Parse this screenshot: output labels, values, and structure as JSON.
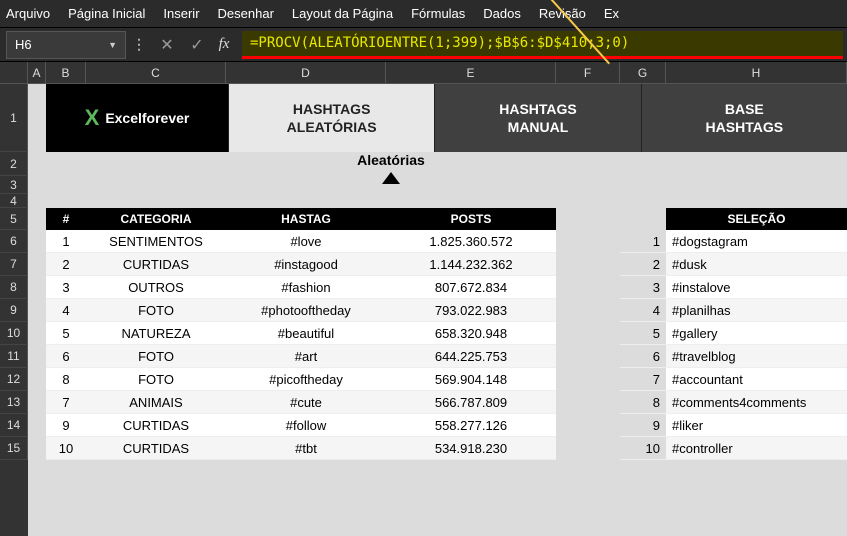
{
  "menu": {
    "items": [
      "Arquivo",
      "Página Inicial",
      "Inserir",
      "Desenhar",
      "Layout da Página",
      "Fórmulas",
      "Dados",
      "Revisão",
      "Ex"
    ]
  },
  "namebox": {
    "value": "H6"
  },
  "formula": {
    "value": "=PROCV(ALEATÓRIOENTRE(1;399);$B$6:$D$410;3;0)"
  },
  "columns": {
    "labels": [
      "A",
      "B",
      "C",
      "D",
      "E",
      "F",
      "G",
      "H"
    ],
    "widths": [
      18,
      40,
      140,
      160,
      170,
      64,
      46,
      180
    ]
  },
  "rownumbers": [
    "1",
    "2",
    "3",
    "4",
    "5",
    "6",
    "7",
    "8",
    "9",
    "10",
    "11",
    "12",
    "13",
    "14",
    "15"
  ],
  "brand": {
    "text": "Excelforever"
  },
  "tabs": [
    {
      "label": "HASHTAGS\nALEATÓRIAS",
      "active": true
    },
    {
      "label": "HASHTAGS\nMANUAL",
      "active": false
    },
    {
      "label": "BASE\nHASHTAGS",
      "active": false
    }
  ],
  "subheader": {
    "label": "Aleatórias"
  },
  "left_table": {
    "headers": [
      "#",
      "CATEGORIA",
      "HASTAG",
      "POSTS"
    ],
    "rows": [
      {
        "n": "1",
        "cat": "SENTIMENTOS",
        "tag": "#love",
        "posts": "1.825.360.572"
      },
      {
        "n": "2",
        "cat": "CURTIDAS",
        "tag": "#instagood",
        "posts": "1.144.232.362"
      },
      {
        "n": "3",
        "cat": "OUTROS",
        "tag": "#fashion",
        "posts": "807.672.834"
      },
      {
        "n": "4",
        "cat": "FOTO",
        "tag": "#photooftheday",
        "posts": "793.022.983"
      },
      {
        "n": "5",
        "cat": "NATUREZA",
        "tag": "#beautiful",
        "posts": "658.320.948"
      },
      {
        "n": "6",
        "cat": "FOTO",
        "tag": "#art",
        "posts": "644.225.753"
      },
      {
        "n": "8",
        "cat": "FOTO",
        "tag": "#picoftheday",
        "posts": "569.904.148"
      },
      {
        "n": "7",
        "cat": "ANIMAIS",
        "tag": "#cute",
        "posts": "566.787.809"
      },
      {
        "n": "9",
        "cat": "CURTIDAS",
        "tag": "#follow",
        "posts": "558.277.126"
      },
      {
        "n": "10",
        "cat": "CURTIDAS",
        "tag": "#tbt",
        "posts": "534.918.230"
      }
    ]
  },
  "right_table": {
    "header": "SELEÇÃO",
    "rows": [
      {
        "n": "1",
        "tag": "#dogstagram"
      },
      {
        "n": "2",
        "tag": "#dusk"
      },
      {
        "n": "3",
        "tag": "#instalove"
      },
      {
        "n": "4",
        "tag": "#planilhas"
      },
      {
        "n": "5",
        "tag": "#gallery"
      },
      {
        "n": "6",
        "tag": "#travelblog"
      },
      {
        "n": "7",
        "tag": "#accountant"
      },
      {
        "n": "8",
        "tag": "#comments4comments"
      },
      {
        "n": "9",
        "tag": "#liker"
      },
      {
        "n": "10",
        "tag": "#controller"
      }
    ]
  }
}
